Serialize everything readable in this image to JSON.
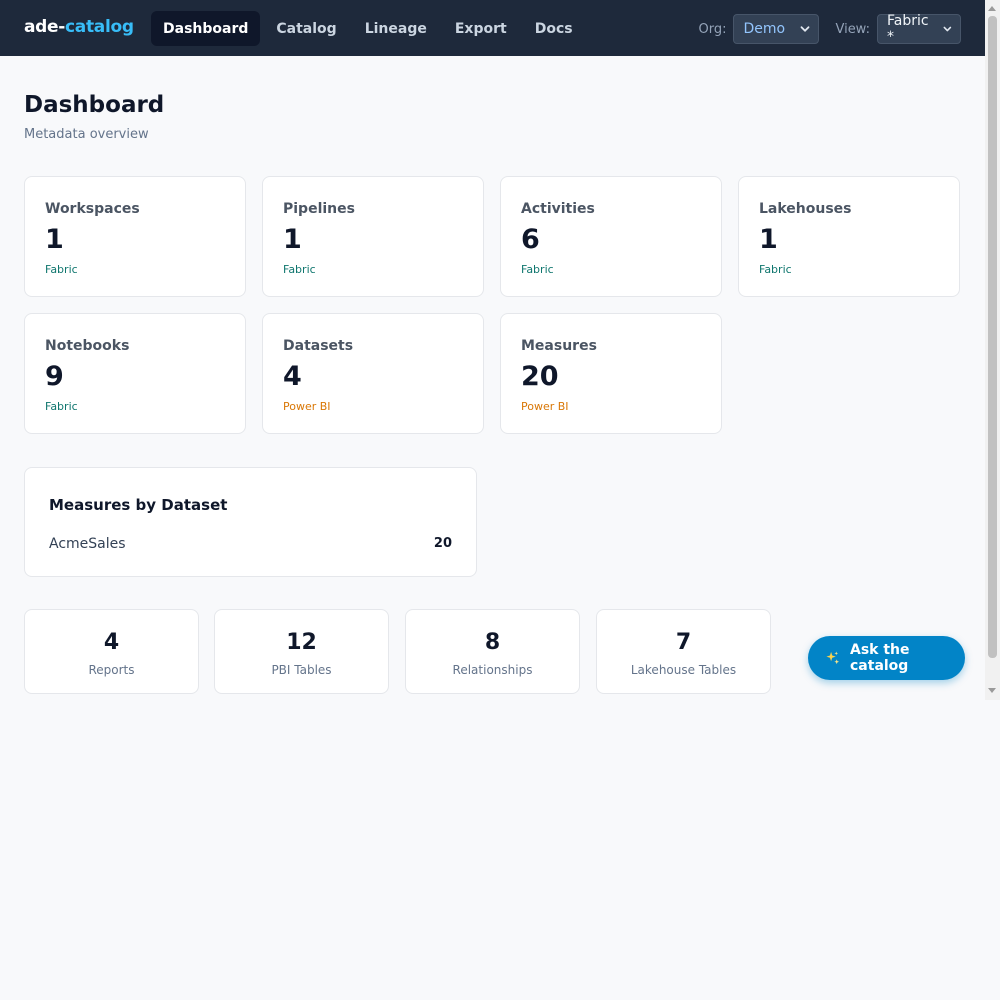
{
  "brand": {
    "part1": "ade-",
    "part2": "catalog"
  },
  "nav": [
    {
      "label": "Dashboard",
      "active": true
    },
    {
      "label": "Catalog"
    },
    {
      "label": "Lineage"
    },
    {
      "label": "Export"
    },
    {
      "label": "Docs"
    }
  ],
  "org": {
    "label": "Org:",
    "value": "Demo"
  },
  "view": {
    "label": "View:",
    "value": "Fabric *"
  },
  "header": {
    "title": "Dashboard",
    "subtitle": "Metadata overview"
  },
  "stats": [
    {
      "label": "Workspaces",
      "value": "1",
      "source": "Fabric"
    },
    {
      "label": "Pipelines",
      "value": "1",
      "source": "Fabric"
    },
    {
      "label": "Activities",
      "value": "6",
      "source": "Fabric"
    },
    {
      "label": "Lakehouses",
      "value": "1",
      "source": "Fabric"
    },
    {
      "label": "Notebooks",
      "value": "9",
      "source": "Fabric"
    },
    {
      "label": "Datasets",
      "value": "4",
      "source": "Power BI"
    },
    {
      "label": "Measures",
      "value": "20",
      "source": "Power BI"
    }
  ],
  "measures_by_dataset": {
    "title": "Measures by Dataset",
    "rows": [
      {
        "name": "AcmeSales",
        "count": "20"
      }
    ]
  },
  "summary": [
    {
      "value": "4",
      "label": "Reports"
    },
    {
      "value": "12",
      "label": "PBI Tables"
    },
    {
      "value": "8",
      "label": "Relationships"
    },
    {
      "value": "7",
      "label": "Lakehouse Tables"
    }
  ],
  "ask_button": {
    "label": "Ask the catalog",
    "icon": "sparkles-icon"
  },
  "colors": {
    "topbar": "#1e293b",
    "accent": "#38bdf8",
    "fabric": "#0f766e",
    "powerbi": "#d97706",
    "ask": "#0284c7"
  }
}
